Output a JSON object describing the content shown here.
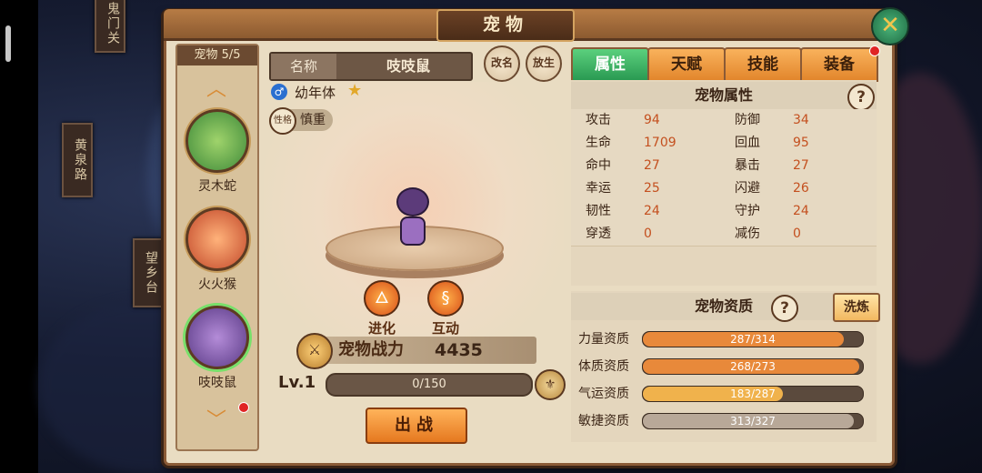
{
  "window": {
    "title": "宠物"
  },
  "side_signs": [
    "鬼门关",
    "黄泉路",
    "望乡台"
  ],
  "pet_list": {
    "header": "宠物 5/5",
    "pets": [
      {
        "name": "灵木蛇"
      },
      {
        "name": "火火猴"
      },
      {
        "name": "吱吱鼠"
      }
    ]
  },
  "pet_info": {
    "name_label": "名称",
    "name_value": "吱吱鼠",
    "growth_stage": "幼年体",
    "personality_icon": "性格",
    "personality": "慎重",
    "rename_button": "改名",
    "release_button": "放生"
  },
  "actions": {
    "evolve": "进化",
    "interact": "互动"
  },
  "combat_power": {
    "label": "宠物战力",
    "value": "4435"
  },
  "level": {
    "label": "Lv.1",
    "exp_text": "0/150",
    "exp_fraction": 0.0
  },
  "deploy_button": "出战",
  "tabs": [
    {
      "label": "属性",
      "active": true
    },
    {
      "label": "天赋",
      "active": false
    },
    {
      "label": "技能",
      "active": false
    },
    {
      "label": "装备",
      "active": false
    }
  ],
  "attributes": {
    "title": "宠物属性",
    "help": "?",
    "rows": [
      {
        "l_name": "攻击",
        "l_value": "94",
        "r_name": "防御",
        "r_value": "34"
      },
      {
        "l_name": "生命",
        "l_value": "1709",
        "r_name": "回血",
        "r_value": "95"
      },
      {
        "l_name": "命中",
        "l_value": "27",
        "r_name": "暴击",
        "r_value": "27"
      },
      {
        "l_name": "幸运",
        "l_value": "25",
        "r_name": "闪避",
        "r_value": "26"
      },
      {
        "l_name": "韧性",
        "l_value": "24",
        "r_name": "守护",
        "r_value": "24"
      },
      {
        "l_name": "穿透",
        "l_value": "0",
        "r_name": "减伤",
        "r_value": "0"
      }
    ]
  },
  "aptitude": {
    "title": "宠物资质",
    "help": "?",
    "wash_button": "洗炼",
    "rows": [
      {
        "name": "力量资质",
        "text": "287/314",
        "fraction": 0.914,
        "color": "#e8893a"
      },
      {
        "name": "体质资质",
        "text": "268/273",
        "fraction": 0.982,
        "color": "#e8893a"
      },
      {
        "name": "气运资质",
        "text": "183/287",
        "fraction": 0.638,
        "color": "#f0b24c"
      },
      {
        "name": "敏捷资质",
        "text": "313/327",
        "fraction": 0.957,
        "color": "#b8a898"
      }
    ]
  },
  "colors": {
    "accent_green": "#2a9a52",
    "tab_orange": "#e2862c",
    "value_red": "#c4501f"
  }
}
